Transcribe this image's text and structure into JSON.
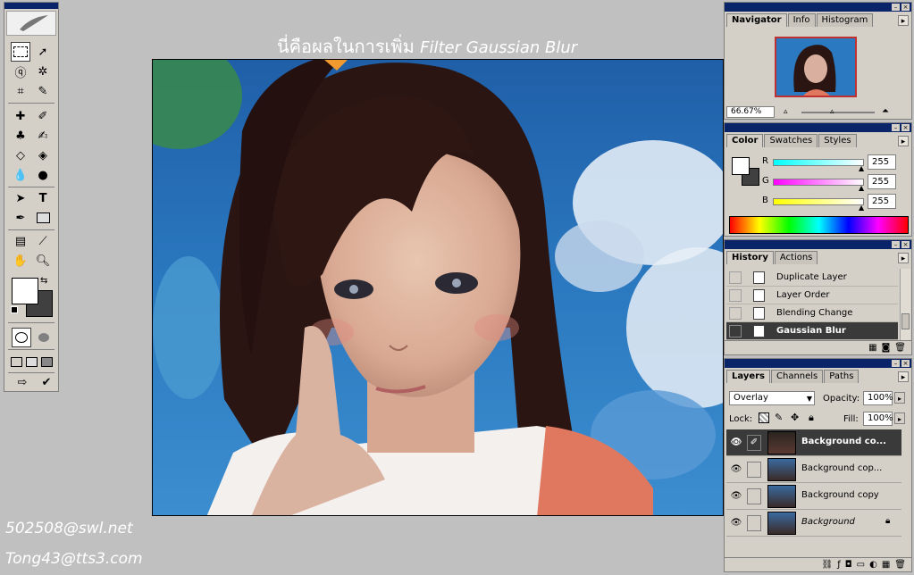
{
  "overlay_title": {
    "thai": "นี่คือผลในการเพิ่ม",
    "filter": "Filter Gaussian Blur"
  },
  "navigator": {
    "tabs": [
      "Navigator",
      "Info",
      "Histogram"
    ],
    "zoom": "66.67%"
  },
  "color": {
    "tabs": [
      "Color",
      "Swatches",
      "Styles"
    ],
    "channels": [
      {
        "label": "R",
        "value": "255"
      },
      {
        "label": "G",
        "value": "255"
      },
      {
        "label": "B",
        "value": "255"
      }
    ]
  },
  "history": {
    "tabs": [
      "History",
      "Actions"
    ],
    "items": [
      "Duplicate Layer",
      "Layer Order",
      "Blending Change",
      "Gaussian Blur"
    ],
    "active_index": 3
  },
  "layers": {
    "tabs": [
      "Layers",
      "Channels",
      "Paths"
    ],
    "blend_mode": "Overlay",
    "opacity_label": "Opacity:",
    "opacity": "100%",
    "lock_label": "Lock:",
    "fill_label": "Fill:",
    "fill": "100%",
    "items": [
      "Background co...",
      "Background cop...",
      "Background copy",
      "Background"
    ],
    "active_index": 0
  },
  "watermarks": [
    "502508@swl.net",
    "Tong43@tts3.com"
  ],
  "colors": {
    "bg": "#c0c0c0",
    "panel": "#d4d0c8",
    "titlebar": "#0a246a",
    "selected_row": "#3a3a3a"
  }
}
